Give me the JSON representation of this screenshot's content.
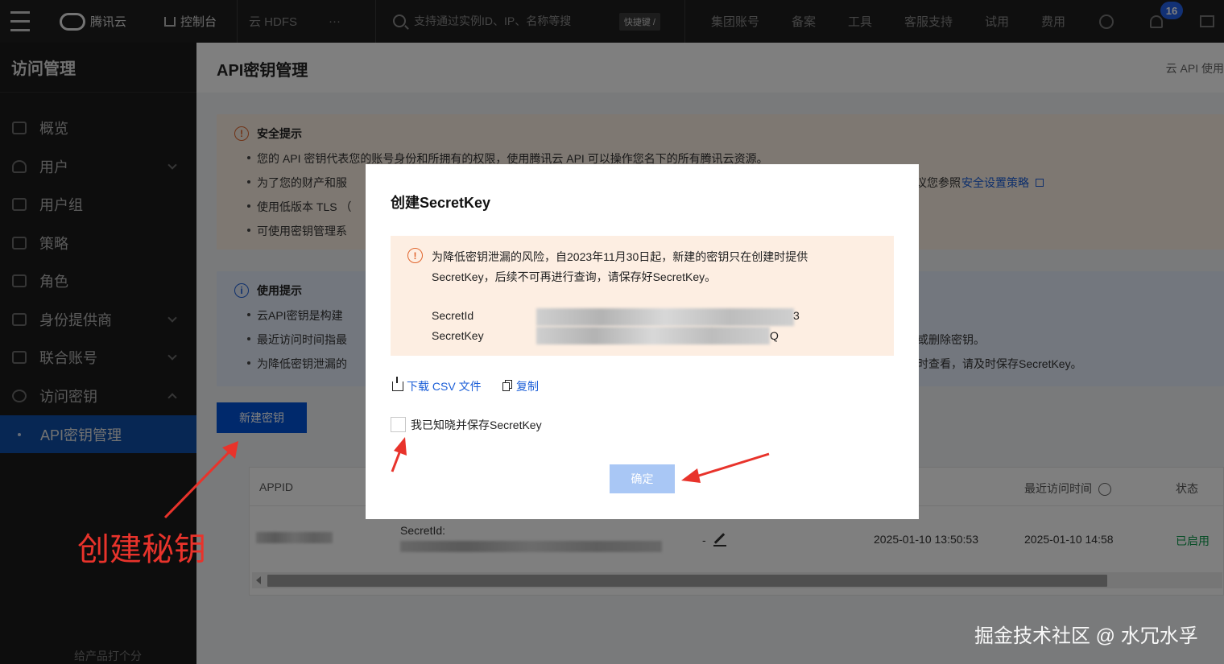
{
  "topbar": {
    "brand": "腾讯云",
    "console": "控制台",
    "hdfs": "云 HDFS",
    "more": "···",
    "search_placeholder": "支持通过实例ID、IP、名称等搜",
    "shortcut": "快捷键 /",
    "nav": [
      "集团账号",
      "备案",
      "工具",
      "客服支持",
      "试用",
      "费用"
    ],
    "badge": "16"
  },
  "sidebar": {
    "title": "访问管理",
    "items": [
      {
        "label": "概览",
        "icon": "grid-icon"
      },
      {
        "label": "用户",
        "icon": "user-icon"
      },
      {
        "label": "用户组",
        "icon": "users-icon"
      },
      {
        "label": "策略",
        "icon": "policy-icon"
      },
      {
        "label": "角色",
        "icon": "role-icon"
      },
      {
        "label": "身份提供商",
        "icon": "idp-icon"
      },
      {
        "label": "联合账号",
        "icon": "federation-icon"
      },
      {
        "label": "访问密钥",
        "icon": "key-icon"
      },
      {
        "label": "API密钥管理",
        "icon": "dot-icon"
      }
    ]
  },
  "page": {
    "title": "API密钥管理",
    "header_link": "云 API 使用"
  },
  "security": {
    "title": "安全提示",
    "lines": [
      "您的 API 密钥代表您的账号身份和所拥有的权限，使用腾讯云 API 可以操作您名下的所有腾讯云资源。",
      "为了您的财产和服",
      "使用低版本 TLS （",
      "可使用密钥管理系"
    ],
    "right_text": "议您参照",
    "right_link": "安全设置策略"
  },
  "usage": {
    "title": "使用提示",
    "lines": [
      "云API密钥是构建",
      "最近访问时间指最",
      "为降低密钥泄漏的"
    ],
    "right_lines": [
      "或删除密钥。",
      "时查看，请及时保存SecretKey。"
    ]
  },
  "new_key_button": "新建密钥",
  "table": {
    "headers": [
      "APPID",
      "最近访问时间",
      "状态"
    ],
    "row": {
      "secret_label": "SecretId:",
      "dash": "-",
      "created": "2025-01-10 13:50:53",
      "last_access": "2025-01-10 14:58",
      "status": "已启用"
    }
  },
  "modal": {
    "title": "创建SecretKey",
    "warning_line1": "为降低密钥泄漏的风险，自2023年11月30日起，新建的密钥只在创建时提供",
    "warning_line2": "SecretKey，后续不可再进行查询，请保存好SecretKey。",
    "secret_id_label": "SecretId",
    "secret_id_end": "3",
    "secret_key_label": "SecretKey",
    "secret_key_end": "Q",
    "download": "下载 CSV 文件",
    "copy": "复制",
    "checkbox_label": "我已知晓并保存SecretKey",
    "confirm": "确定"
  },
  "annotation": "创建秘钥",
  "watermark": "掘金技术社区 @ 水冗水孚",
  "sidebar_bottom": "给产品打个分",
  "colors": {
    "accent": "#0052d9",
    "annotation": "#e8332b",
    "warning": "#e0642c",
    "success": "#0a9a4a"
  }
}
